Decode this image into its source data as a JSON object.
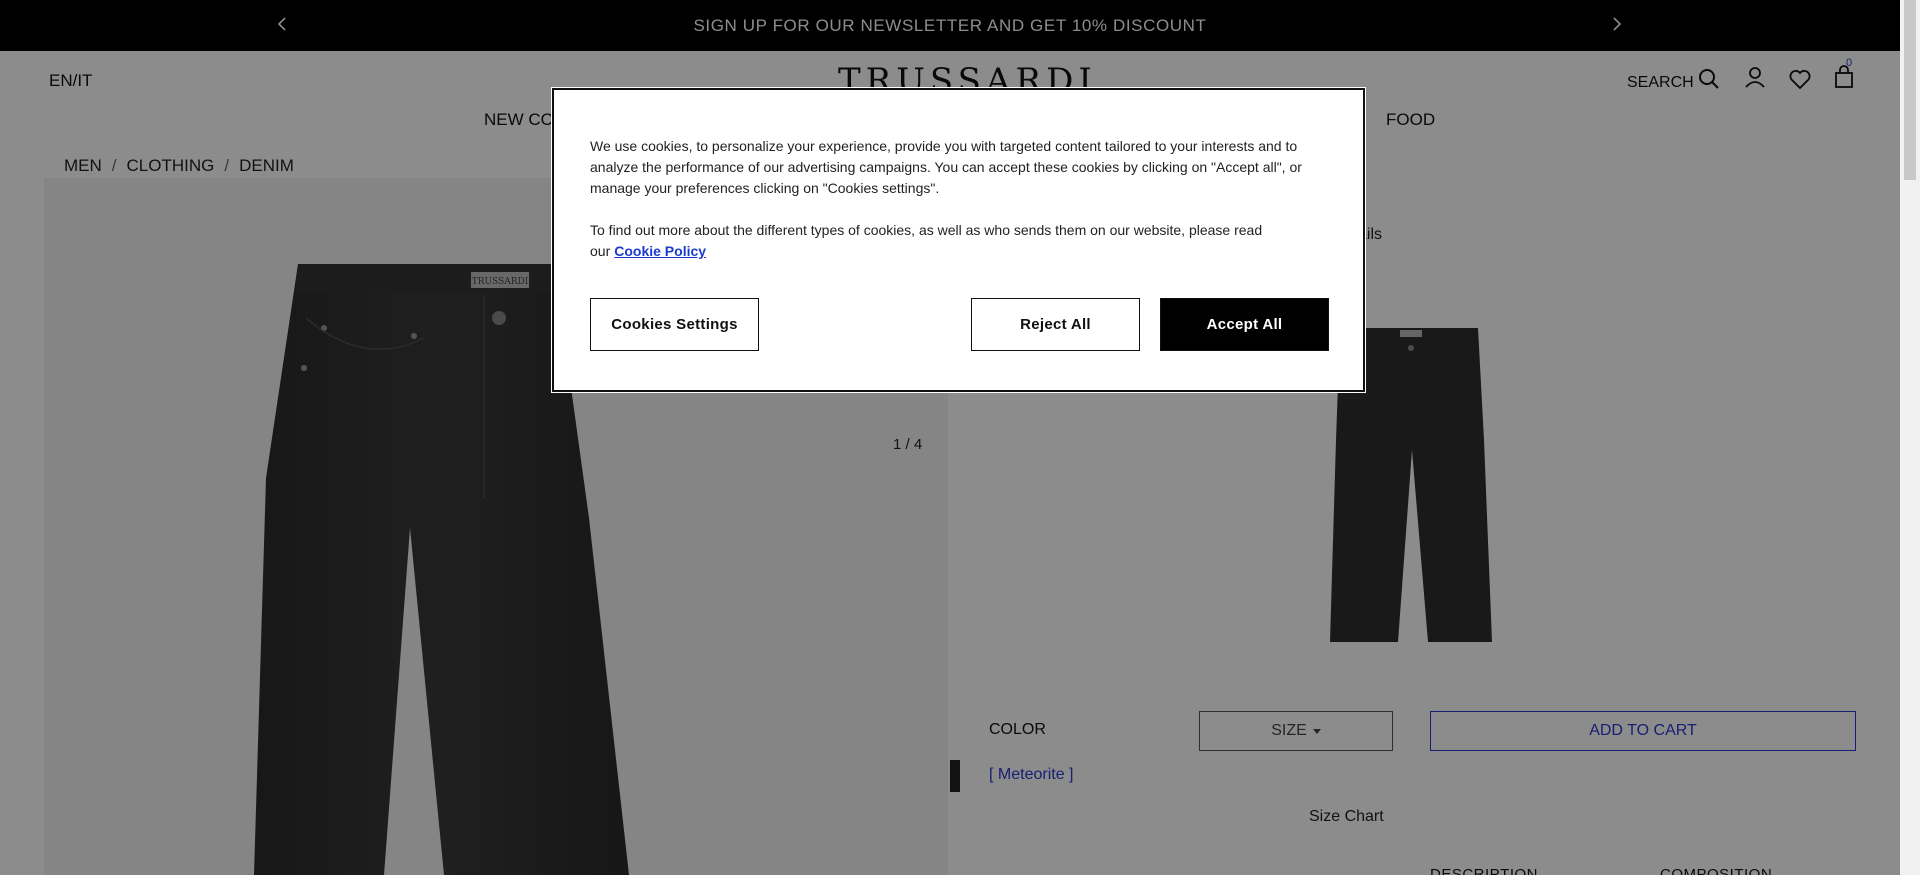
{
  "promo": {
    "text": "SIGN UP FOR OUR NEWSLETTER AND GET 10% DISCOUNT"
  },
  "header": {
    "lang": "EN/IT",
    "logo": "TRUSSARDI",
    "search_label": "SEARCH",
    "bag_count": "0"
  },
  "nav": {
    "item_newco": "NEW CO",
    "item_food": "FOOD"
  },
  "breadcrumb": {
    "items": [
      "MEN",
      "CLOTHING",
      "DENIM"
    ],
    "separator": "/"
  },
  "gallery": {
    "counter": "1 / 4"
  },
  "product": {
    "details_link": "ails",
    "color_label": "COLOR",
    "color_value": "[ Meteorite ]",
    "size_label": "SIZE",
    "add_to_cart": "ADD TO CART",
    "size_chart": "Size Chart",
    "tab_description": "DESCRIPTION",
    "tab_composition": "COMPOSITION",
    "label_tag": "TRUSSARDI"
  },
  "cookie": {
    "p1": "We use cookies, to personalize your experience, provide you with targeted content tailored to your interests and to analyze the performance of our advertising campaigns. You can accept these cookies by clicking on \"Accept all\", or manage your preferences clicking on \"Cookies settings\".",
    "p2": "To find out more about the different types of cookies, as well as who sends them on our website, please read our",
    "policy_link": "Cookie Policy",
    "settings_button": "Cookies Settings",
    "reject_button": "Reject All",
    "accept_button": "Accept All"
  },
  "colors": {
    "accent_blue": "#2a3ad0",
    "promo_bg": "#000000"
  }
}
